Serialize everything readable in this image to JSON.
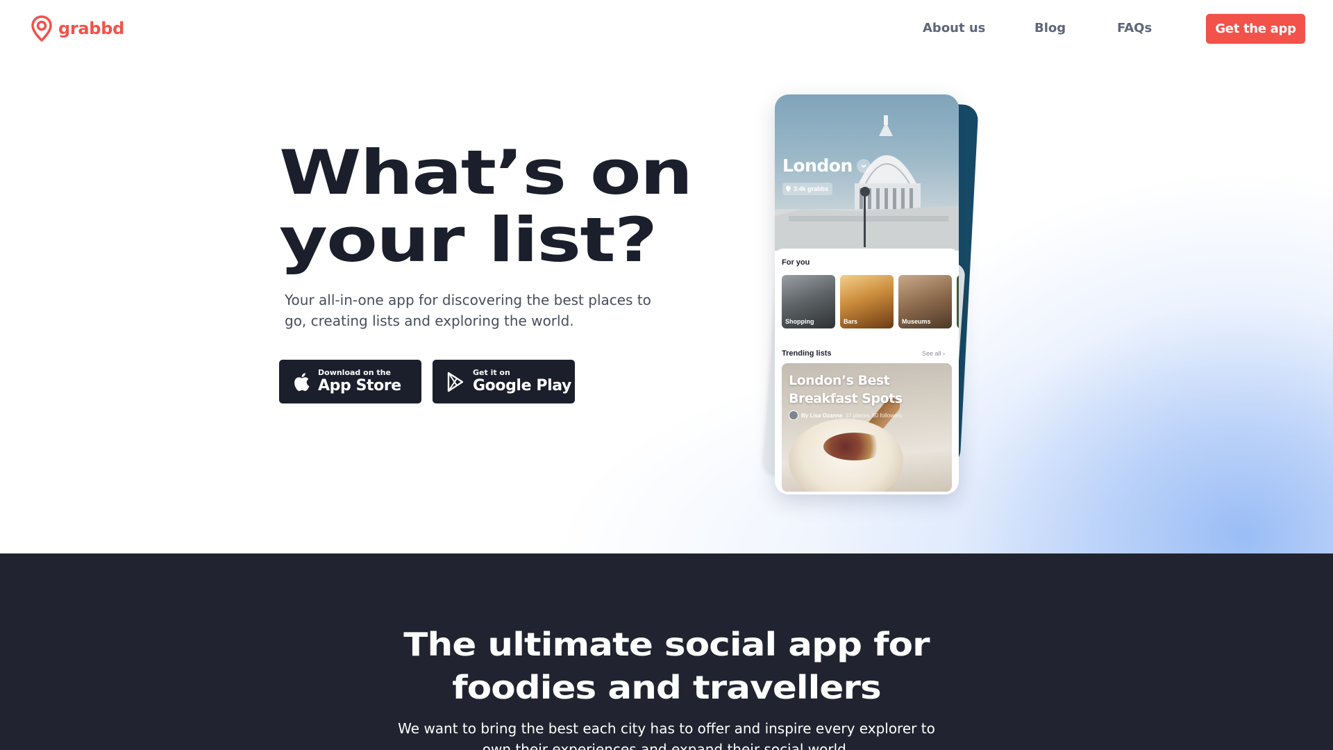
{
  "brand": {
    "name": "grabbd",
    "color": "#f2524a",
    "icon": "location-pin-icon"
  },
  "nav": {
    "items": [
      {
        "label": "About us"
      },
      {
        "label": "Blog"
      },
      {
        "label": "FAQs"
      }
    ],
    "cta_label": "Get the app"
  },
  "hero": {
    "headline_line1": "What’s on",
    "headline_line2": "your list?",
    "subtext": "Your all-in-one app for discovering the best places to go, creating lists and exploring the world.",
    "app_store": {
      "small": "Download on the",
      "big": "App Store",
      "icon": "apple-icon"
    },
    "google_play": {
      "small": "Get it on",
      "big": "Google Play",
      "icon": "play-icon"
    }
  },
  "phone": {
    "city": "London",
    "grabbs": "3.4k grabbs",
    "for_you_title": "For you",
    "categories": [
      {
        "label": "Shopping"
      },
      {
        "label": "Bars"
      },
      {
        "label": "Museums"
      }
    ],
    "trending_title": "Trending lists",
    "see_all": "See all",
    "list_card": {
      "title": "London’s Best Breakfast Spots",
      "author": "By Lisa Ozanne",
      "stats": "37 places, 60 followers"
    }
  },
  "section2": {
    "title_line1": "The ultimate social app for",
    "title_line2": "foodies and travellers",
    "text": "We want to bring the best each city has to offer and inspire every explorer to own their experiences and expand their social world."
  },
  "colors": {
    "accent": "#f2524a",
    "dark": "#1b1e2b",
    "section_bg": "#212430"
  }
}
